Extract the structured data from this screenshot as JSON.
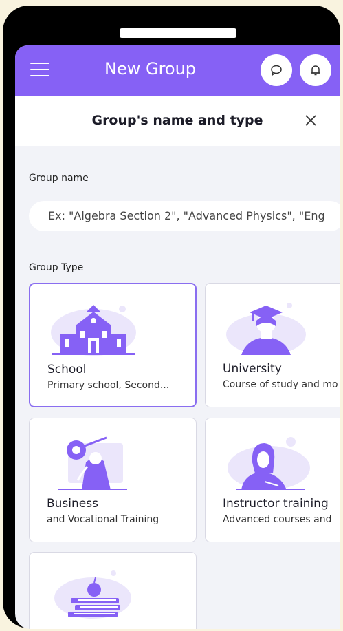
{
  "header": {
    "title": "New Group"
  },
  "modal": {
    "title": "Group's name and type"
  },
  "form": {
    "group_name_label": "Group name",
    "group_name_placeholder": "Ex: \"Algebra Section 2\", \"Advanced Physics\", \"Eng",
    "group_type_label": "Group Type"
  },
  "group_types": [
    {
      "title": "School",
      "description": "Primary school, Second...",
      "selected": true
    },
    {
      "title": "University",
      "description": "Course of study and mo",
      "selected": false
    },
    {
      "title": "Business",
      "description": "and Vocational Training",
      "selected": false
    },
    {
      "title": "Instructor training",
      "description": "Advanced courses and",
      "selected": false
    },
    {
      "title": "",
      "description": "",
      "selected": false
    }
  ],
  "icons": [
    "menu-icon",
    "chat-bubble-icon",
    "bell-icon",
    "close-icon"
  ],
  "colors": {
    "accent": "#8661f5",
    "background": "#f2f3f8",
    "frame": "#000000",
    "outer": "#f9f3df"
  }
}
